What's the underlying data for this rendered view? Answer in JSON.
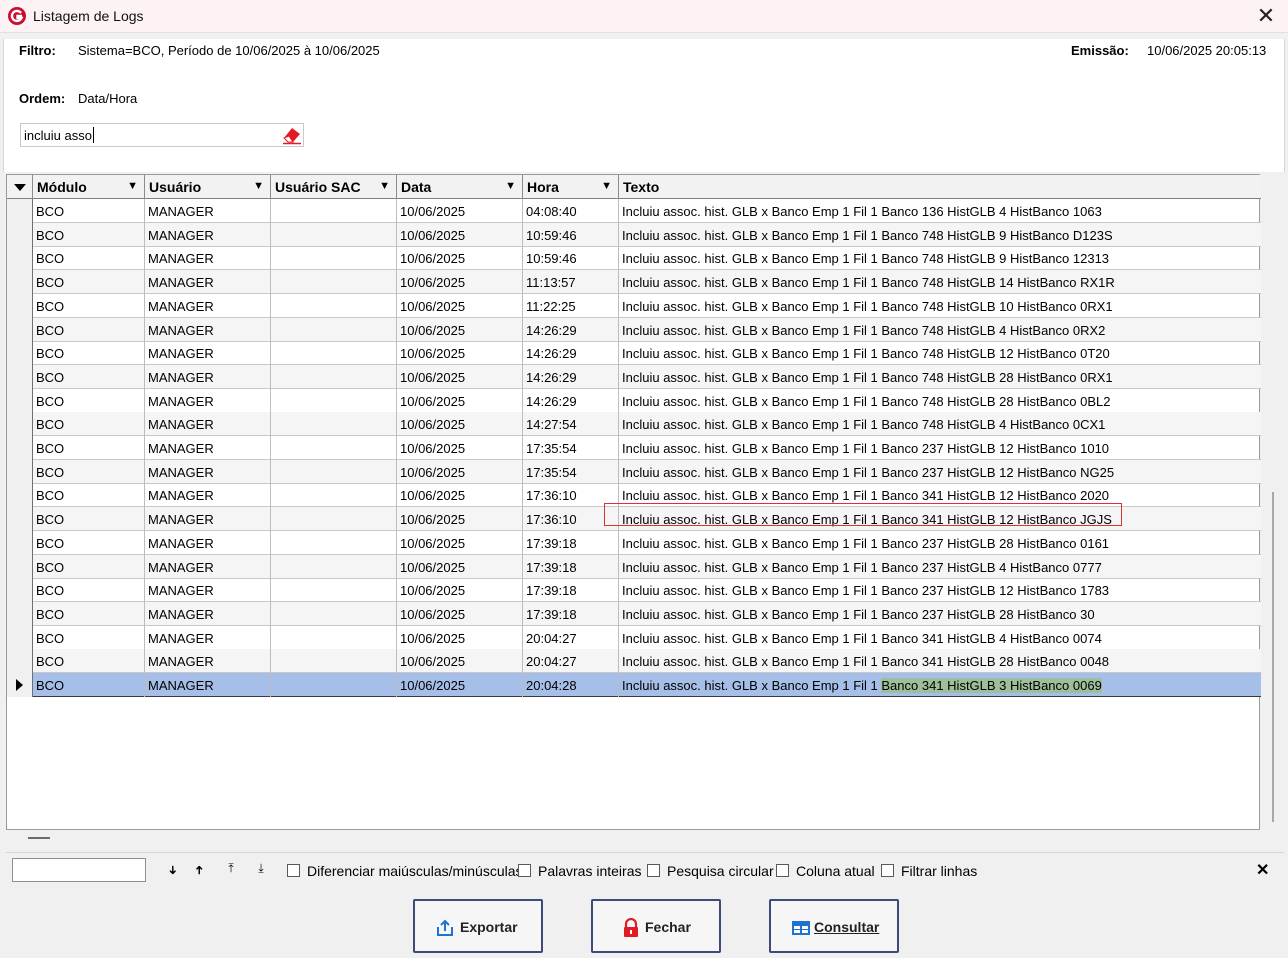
{
  "window": {
    "title": "Listagem de Logs"
  },
  "header": {
    "filtro_label": "Filtro:",
    "filtro_value": "Sistema=BCO, Período de 10/06/2025 à 10/06/2025",
    "emissao_label": "Emissão:",
    "emissao_value": "10/06/2025 20:05:13",
    "ordem_label": "Ordem:",
    "ordem_value": "Data/Hora",
    "search_value": "incluiu asso"
  },
  "grid": {
    "columns": [
      "Módulo",
      "Usuário",
      "Usuário SAC",
      "Data",
      "Hora",
      "Texto"
    ],
    "rows": [
      {
        "modulo": "BCO",
        "usuario": "MANAGER",
        "sac": "",
        "data": "10/06/2025",
        "hora": "04:08:40",
        "texto": "Incluiu assoc. hist. GLB x Banco  Emp 1 Fil 1 Banco 136 HistGLB 4 HistBanco 1063"
      },
      {
        "modulo": "BCO",
        "usuario": "MANAGER",
        "sac": "",
        "data": "10/06/2025",
        "hora": "10:59:46",
        "texto": "Incluiu assoc. hist. GLB x Banco  Emp 1 Fil 1 Banco 748 HistGLB 9 HistBanco D123S"
      },
      {
        "modulo": "BCO",
        "usuario": "MANAGER",
        "sac": "",
        "data": "10/06/2025",
        "hora": "10:59:46",
        "texto": "Incluiu assoc. hist. GLB x Banco  Emp 1 Fil 1 Banco 748 HistGLB 9 HistBanco 12313"
      },
      {
        "modulo": "BCO",
        "usuario": "MANAGER",
        "sac": "",
        "data": "10/06/2025",
        "hora": "11:13:57",
        "texto": "Incluiu assoc. hist. GLB x Banco  Emp 1 Fil 1 Banco 748 HistGLB 14 HistBanco RX1R"
      },
      {
        "modulo": "BCO",
        "usuario": "MANAGER",
        "sac": "",
        "data": "10/06/2025",
        "hora": "11:22:25",
        "texto": "Incluiu assoc. hist. GLB x Banco  Emp 1 Fil 1 Banco 748 HistGLB 10 HistBanco 0RX1"
      },
      {
        "modulo": "BCO",
        "usuario": "MANAGER",
        "sac": "",
        "data": "10/06/2025",
        "hora": "14:26:29",
        "texto": "Incluiu assoc. hist. GLB x Banco  Emp 1 Fil 1 Banco 748 HistGLB 4 HistBanco 0RX2"
      },
      {
        "modulo": "BCO",
        "usuario": "MANAGER",
        "sac": "",
        "data": "10/06/2025",
        "hora": "14:26:29",
        "texto": "Incluiu assoc. hist. GLB x Banco  Emp 1 Fil 1 Banco 748 HistGLB 12 HistBanco 0T20"
      },
      {
        "modulo": "BCO",
        "usuario": "MANAGER",
        "sac": "",
        "data": "10/06/2025",
        "hora": "14:26:29",
        "texto": "Incluiu assoc. hist. GLB x Banco  Emp 1 Fil 1 Banco 748 HistGLB 28 HistBanco 0RX1"
      },
      {
        "modulo": "BCO",
        "usuario": "MANAGER",
        "sac": "",
        "data": "10/06/2025",
        "hora": "14:26:29",
        "texto": "Incluiu assoc. hist. GLB x Banco  Emp 1 Fil 1 Banco 748 HistGLB 28 HistBanco 0BL2"
      },
      {
        "modulo": "BCO",
        "usuario": "MANAGER",
        "sac": "",
        "data": "10/06/2025",
        "hora": "14:27:54",
        "texto": "Incluiu assoc. hist. GLB x Banco  Emp 1 Fil 1 Banco 748 HistGLB 4 HistBanco 0CX1"
      },
      {
        "modulo": "BCO",
        "usuario": "MANAGER",
        "sac": "",
        "data": "10/06/2025",
        "hora": "17:35:54",
        "texto": "Incluiu assoc. hist. GLB x Banco  Emp 1 Fil 1 Banco 237 HistGLB 12 HistBanco 1010"
      },
      {
        "modulo": "BCO",
        "usuario": "MANAGER",
        "sac": "",
        "data": "10/06/2025",
        "hora": "17:35:54",
        "texto": "Incluiu assoc. hist. GLB x Banco  Emp 1 Fil 1 Banco 237 HistGLB 12 HistBanco NG25"
      },
      {
        "modulo": "BCO",
        "usuario": "MANAGER",
        "sac": "",
        "data": "10/06/2025",
        "hora": "17:36:10",
        "texto": "Incluiu assoc. hist. GLB x Banco  Emp 1 Fil 1 Banco 341 HistGLB 12 HistBanco 2020"
      },
      {
        "modulo": "BCO",
        "usuario": "MANAGER",
        "sac": "",
        "data": "10/06/2025",
        "hora": "17:36:10",
        "texto": "Incluiu assoc. hist. GLB x Banco  Emp 1 Fil 1 Banco 341 HistGLB 12 HistBanco JGJS"
      },
      {
        "modulo": "BCO",
        "usuario": "MANAGER",
        "sac": "",
        "data": "10/06/2025",
        "hora": "17:39:18",
        "texto": "Incluiu assoc. hist. GLB x Banco  Emp 1 Fil 1 Banco 237 HistGLB 28 HistBanco 0161"
      },
      {
        "modulo": "BCO",
        "usuario": "MANAGER",
        "sac": "",
        "data": "10/06/2025",
        "hora": "17:39:18",
        "texto": "Incluiu assoc. hist. GLB x Banco  Emp 1 Fil 1 Banco 237 HistGLB 4 HistBanco 0777"
      },
      {
        "modulo": "BCO",
        "usuario": "MANAGER",
        "sac": "",
        "data": "10/06/2025",
        "hora": "17:39:18",
        "texto": "Incluiu assoc. hist. GLB x Banco  Emp 1 Fil 1 Banco 237 HistGLB 12 HistBanco 1783"
      },
      {
        "modulo": "BCO",
        "usuario": "MANAGER",
        "sac": "",
        "data": "10/06/2025",
        "hora": "17:39:18",
        "texto": "Incluiu assoc. hist. GLB x Banco  Emp 1 Fil 1 Banco 237 HistGLB 28 HistBanco 30"
      },
      {
        "modulo": "BCO",
        "usuario": "MANAGER",
        "sac": "",
        "data": "10/06/2025",
        "hora": "20:04:27",
        "texto": "Incluiu assoc. hist. GLB x Banco  Emp 1 Fil 1 Banco 341 HistGLB 4 HistBanco 0074"
      },
      {
        "modulo": "BCO",
        "usuario": "MANAGER",
        "sac": "",
        "data": "10/06/2025",
        "hora": "20:04:27",
        "texto": "Incluiu assoc. hist. GLB x Banco  Emp 1 Fil 1 Banco 341 HistGLB 28 HistBanco 0048"
      },
      {
        "modulo": "BCO",
        "usuario": "MANAGER",
        "sac": "",
        "data": "10/06/2025",
        "hora": "20:04:28",
        "texto_a": "Incluiu assoc. hist. GLB x Banco  Emp 1 Fil 1 ",
        "texto_b": "Banco 341 HistGLB 3 HistBanco 0069",
        "selected": true
      }
    ]
  },
  "findbar": {
    "input_value": "",
    "options": [
      "Diferenciar maiúsculas/minúsculas",
      "Palavras inteiras",
      "Pesquisa circular",
      "Coluna atual",
      "Filtrar linhas"
    ]
  },
  "buttons": {
    "exportar": "Exportar",
    "fechar": "Fechar",
    "consultar": "Consultar"
  },
  "colors": {
    "selected_row": "#a6bfe9",
    "highlight": "#9dbf9b",
    "button_border": "#3c4b77"
  }
}
